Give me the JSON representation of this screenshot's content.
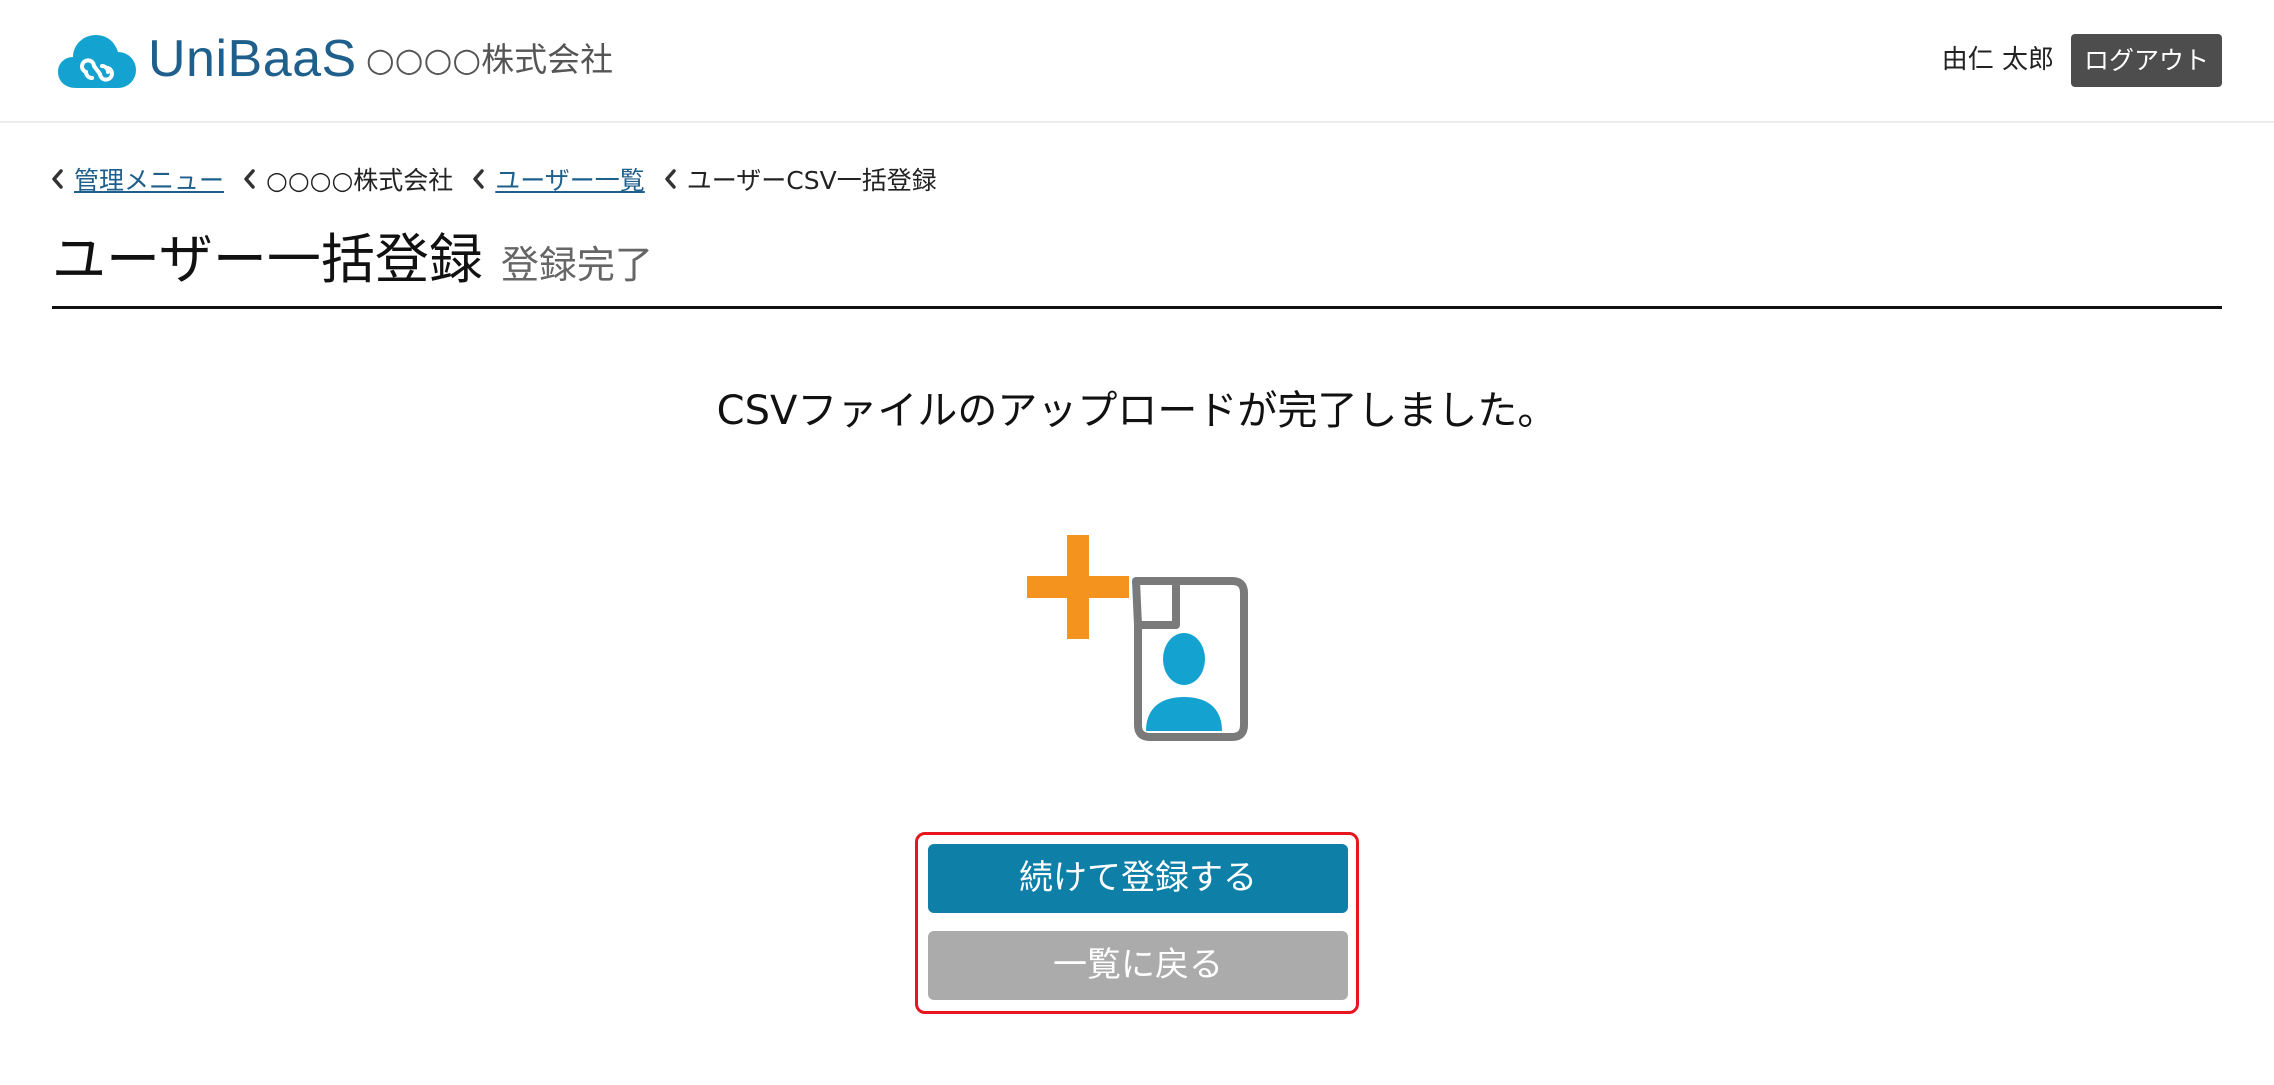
{
  "header": {
    "brand": "UniBaaS",
    "company": "○○○○株式会社",
    "user_name": "由仁 太郎",
    "logout_label": "ログアウト",
    "logo_icon": "cloud-link-icon",
    "brand_color": "#1f5f8c",
    "logo_color": "#14a3d0"
  },
  "breadcrumb": [
    {
      "label": "管理メニュー",
      "link": true
    },
    {
      "label": "○○○○株式会社",
      "link": false
    },
    {
      "label": "ユーザー一覧",
      "link": true
    },
    {
      "label": "ユーザーCSV一括登録",
      "link": false
    }
  ],
  "page": {
    "title": "ユーザー一括登録",
    "subtitle": "登録完了",
    "message": "CSVファイルのアップロードが完了しました。",
    "illustration": "add-user-file-icon"
  },
  "actions": {
    "continue_label": "続けて登録する",
    "back_label": "一覧に戻る",
    "primary_color": "#0e80a8",
    "secondary_color": "#ababab",
    "highlight_color": "#e8151f"
  }
}
